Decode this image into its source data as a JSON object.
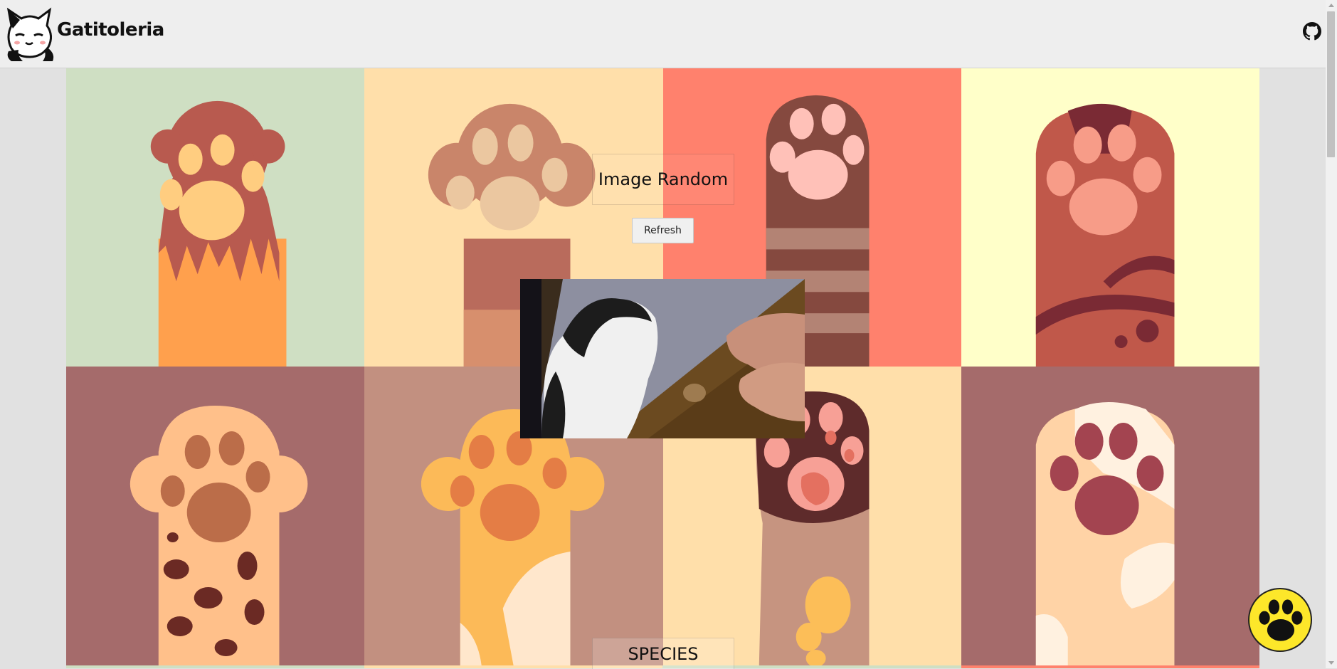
{
  "header": {
    "brand": "Gatitoleria",
    "logo_icon": "cat-logo-icon",
    "github_icon": "github-icon"
  },
  "main": {
    "title": "Image Random",
    "refresh_label": "Refresh",
    "species_title": "SPECIES"
  },
  "colors": {
    "header_bg": "#eeeeee",
    "tile_green": "#cfdfc3",
    "tile_cream": "#ffdfaa",
    "tile_salmon": "#ff816d",
    "tile_lightyellow": "#ffffc9",
    "tile_mauve": "#a56b6b",
    "tile_tan": "#c29080",
    "fab_yellow": "#fde72a"
  },
  "fab": {
    "icon": "paw-icon"
  }
}
